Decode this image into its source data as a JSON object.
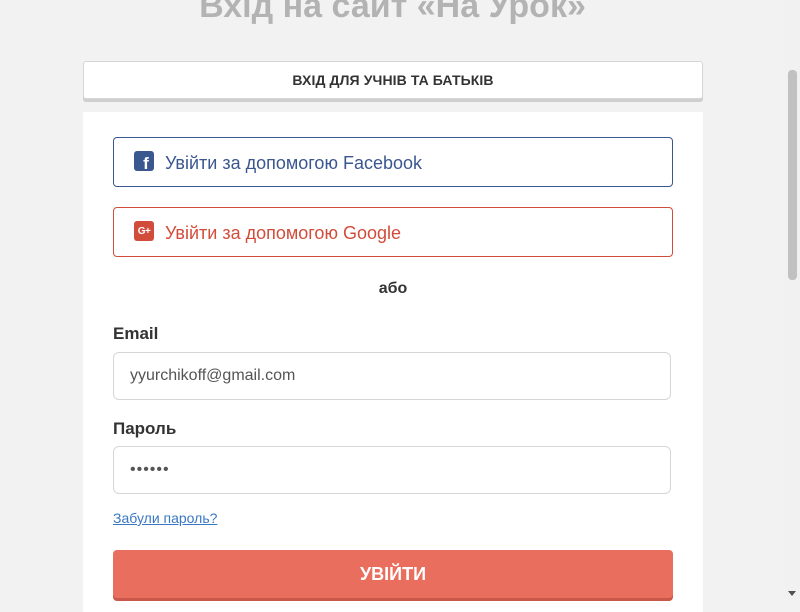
{
  "page": {
    "title": "Вхід на сайт «На Урок»"
  },
  "tabs": {
    "active_label": "ВХІД ДЛЯ УЧНІВ ТА БАТЬКІВ"
  },
  "social": {
    "facebook": {
      "label": "Увійти за допомогою Facebook",
      "icon": "facebook-icon",
      "icon_glyph": "f",
      "color": "#3b5790"
    },
    "google": {
      "label": "Увійти за допомогою Google",
      "icon": "google-plus-icon",
      "icon_glyph": "G+",
      "color": "#d24c3b"
    }
  },
  "divider": "або",
  "form": {
    "email_label": "Email",
    "email_value": "yyurchikoff@gmail.com",
    "password_label": "Пароль",
    "password_value": "••••••",
    "forgot_link": "Забули пароль?",
    "submit_label": "УВІЙТИ",
    "submit_color": "#ea6e5e"
  }
}
